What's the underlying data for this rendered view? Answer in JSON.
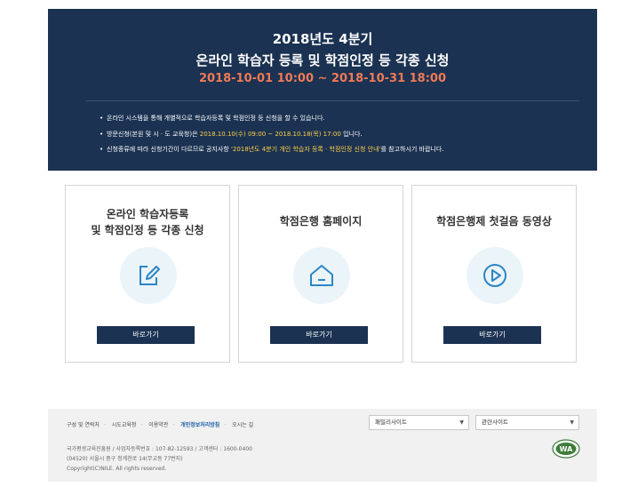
{
  "banner": {
    "title_line1": "2018년도 4분기",
    "title_line2": "온라인 학습자 등록 및 학점인정 등 각종 신청",
    "date_range": "2018-10-01 10:00 ~ 2018-10-31 18:00",
    "notes": [
      {
        "text": "온라인 시스템을 통해 개별적으로 학습자등록 및 학점인정 등 신청을 할 수 있습니다."
      },
      {
        "pre": "방문신청(본원 및 시 · 도 교육청)은 ",
        "highlight": "2018.10.10(수) 09:00 ~ 2018.10.18(목) 17:00",
        "post": " 입니다."
      },
      {
        "pre": "신청종류에 따라 신청기간이 다르므로 공지사항 ",
        "highlight": "'2018년도 4분기 개인 학습자 등록 · 학점인정 신청 안내'",
        "post": "를 참고하시기 바랍니다."
      }
    ]
  },
  "cards": [
    {
      "title_line1": "온라인 학습자등록",
      "title_line2": "및 학점인정 등 각종 신청",
      "icon": "pencil-edit-icon",
      "button": "바로가기"
    },
    {
      "title_line1": "학점은행 홈페이지",
      "title_line2": "",
      "icon": "home-icon",
      "button": "바로가기"
    },
    {
      "title_line1": "학점은행제 첫걸음 동영상",
      "title_line2": "",
      "icon": "play-icon",
      "button": "바로가기"
    }
  ],
  "footer": {
    "links": [
      "구성 및 연락처",
      "시도교육청",
      "이용약관",
      "개인정보처리방침",
      "오시는 길"
    ],
    "family_site": "패밀리사이트",
    "related_site": "관련사이트",
    "info_line1": "국가평생교육진흥원 / 사업자등록번호 : 107-82-12593 / 고객센터 : 1600-0400",
    "info_line2": "(04520) 서울시 중구 청계천로 14(무교동 77번지)",
    "copyright": "Copyright(C)NILE. All rights reserved.",
    "logo_text": "WA"
  },
  "colors": {
    "navy": "#1b3252",
    "date_orange": "#f07a55",
    "highlight_yellow": "#ffcf48",
    "icon_blue": "#2b86c5"
  }
}
